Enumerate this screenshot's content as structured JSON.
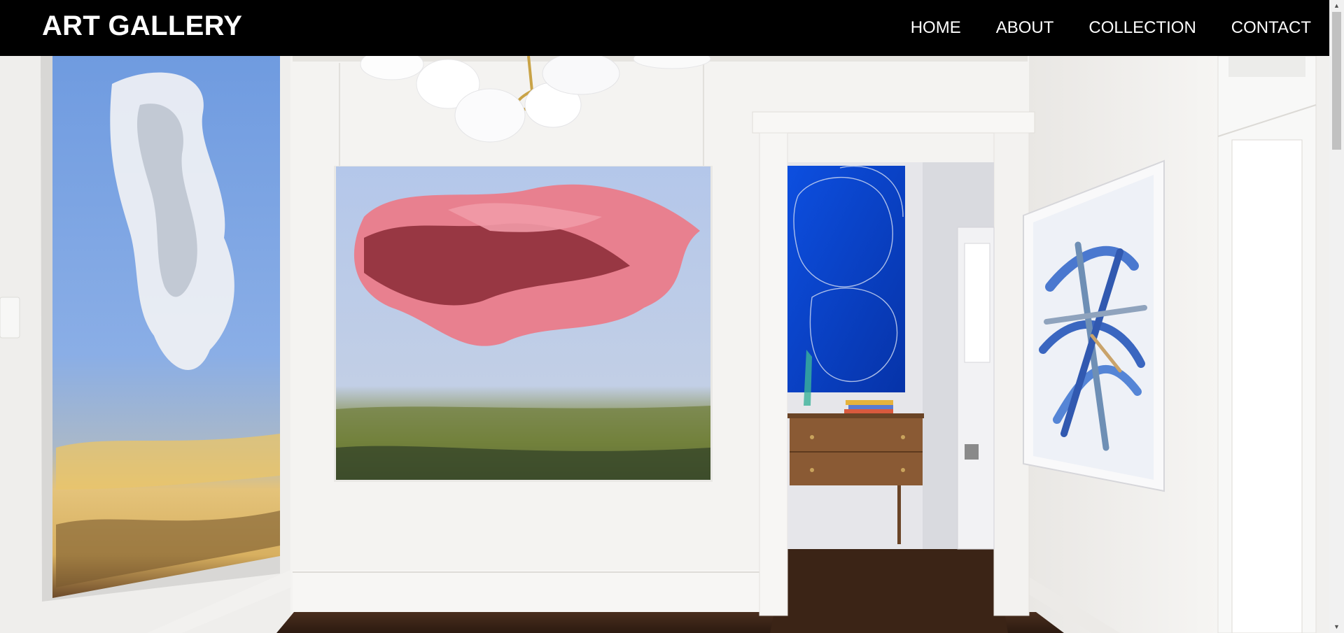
{
  "site": {
    "brand": "ART GALLERY"
  },
  "nav": {
    "items": [
      {
        "label": "HOME"
      },
      {
        "label": "ABOUT"
      },
      {
        "label": "COLLECTION"
      },
      {
        "label": "CONTACT"
      }
    ]
  },
  "hero": {
    "image_alt": "Gallery interior with paintings on white walls"
  },
  "colors": {
    "header_bg": "#000000",
    "header_text": "#ffffff",
    "wall": "#f4f3f1",
    "blue_canvas": "#0a3fc4",
    "pink_cloud": "#e57a8a",
    "floor": "#3a2418"
  },
  "scrollbar": {
    "up_icon": "arrow-up-icon",
    "down_icon": "arrow-down-icon"
  }
}
